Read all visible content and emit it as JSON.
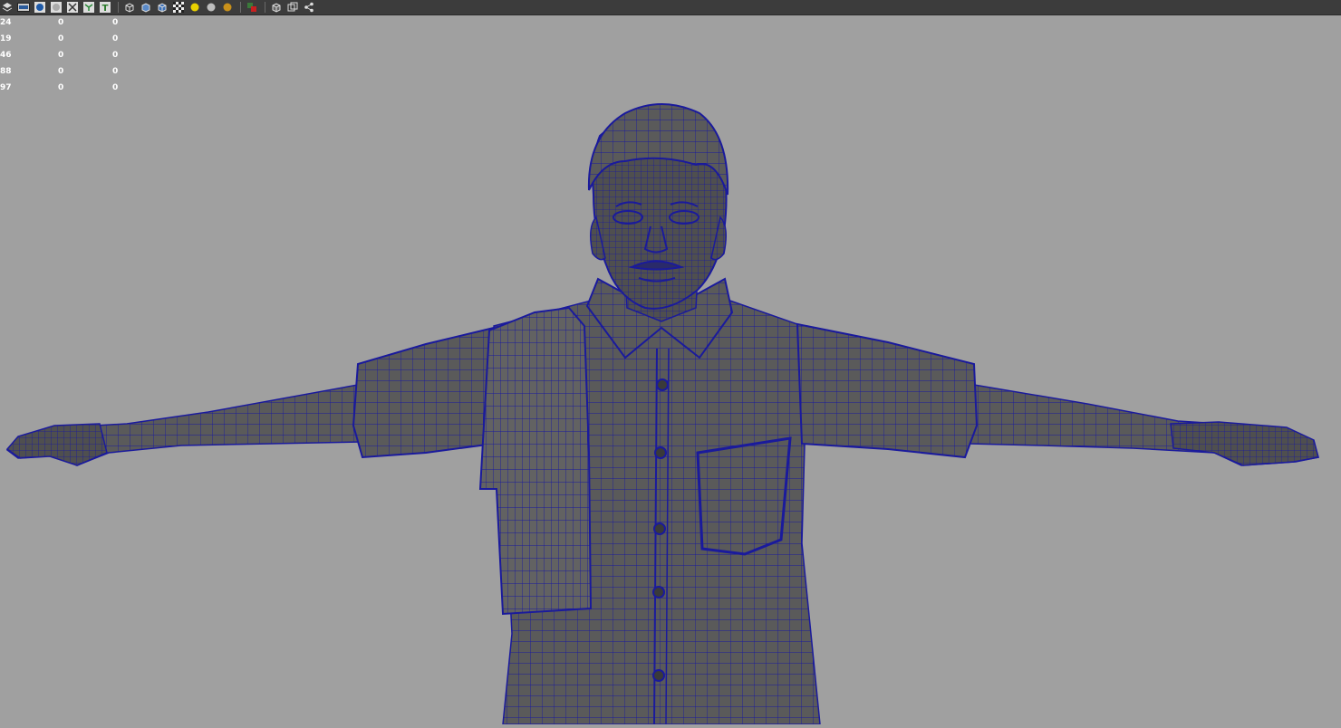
{
  "toolbar": {
    "icons": [
      "layers-icon",
      "film-strip-icon",
      "sphere-shaded-icon",
      "sphere-flat-icon",
      "grid-toggle-icon",
      "uv-icon",
      "text-icon",
      "wireframe-cube-icon",
      "shaded-cube-icon",
      "textured-cube-icon",
      "checker-icon",
      "light-yellow-icon",
      "light-grey-icon",
      "light-gold-icon",
      "color-swatch-icon",
      "isolate-cube-icon",
      "duplicate-cube-icon",
      "share-node-icon"
    ],
    "text_icon_label": "T"
  },
  "hud": {
    "rows": [
      {
        "a": "24",
        "b": "0",
        "c": "0"
      },
      {
        "a": "19",
        "b": "0",
        "c": "0"
      },
      {
        "a": "46",
        "b": "0",
        "c": "0"
      },
      {
        "a": "88",
        "b": "0",
        "c": "0"
      },
      {
        "a": "97",
        "b": "0",
        "c": "0"
      }
    ]
  },
  "viewport": {
    "background": "#a0a0a0",
    "mesh_fill": "#595959",
    "wire_color": "#1a1a9c"
  }
}
